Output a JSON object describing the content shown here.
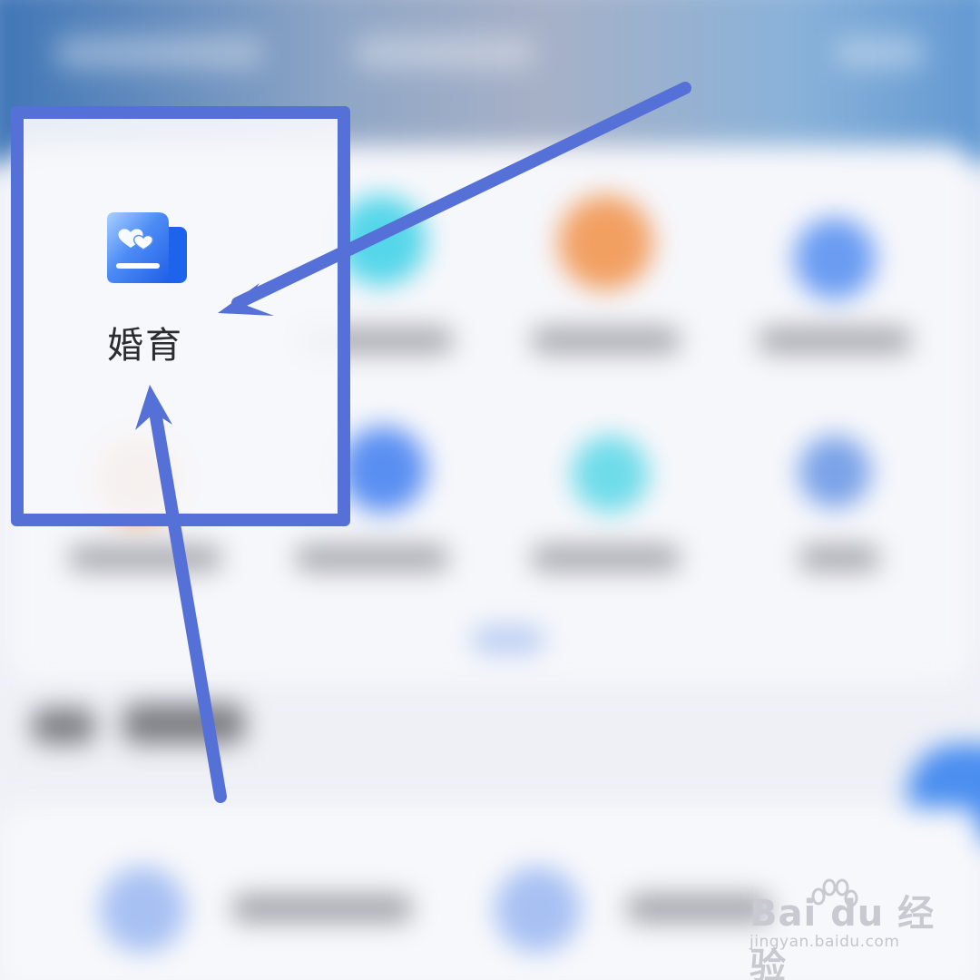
{
  "app_grid": {
    "highlighted_item": {
      "label": "婚育",
      "icon": "marriage-certificate-icon"
    }
  },
  "colors": {
    "highlight_border": "#5570d6",
    "arrow": "#5570d6",
    "icon_blue": "#1e66f0"
  },
  "watermark": {
    "logo": "Bai du 经验",
    "url": "jingyan.baidu.com"
  }
}
